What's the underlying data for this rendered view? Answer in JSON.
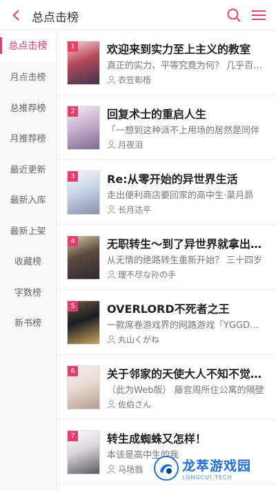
{
  "header": {
    "title": "总点击榜",
    "accent": "#e83c6a"
  },
  "sidebar": {
    "items": [
      {
        "label": "总点击榜",
        "active": true
      },
      {
        "label": "月点击榜"
      },
      {
        "label": "总推荐榜"
      },
      {
        "label": "月推荐榜"
      },
      {
        "label": "最近更新"
      },
      {
        "label": "最新入库"
      },
      {
        "label": "最新上架"
      },
      {
        "label": "收藏榜"
      },
      {
        "label": "字数榜"
      },
      {
        "label": "新书榜"
      }
    ]
  },
  "books": [
    {
      "rank": "1",
      "title": "欢迎来到实力至上主义的教室",
      "desc": "真正的实力、平等究竟为何？ 几乎百分之百",
      "author": "衣笠彰梧",
      "cover_colors": [
        "#b7485a",
        "#f2d7d5",
        "#3d3550"
      ]
    },
    {
      "rank": "2",
      "title": "回复术士的重启人生",
      "desc": "「一想到这种派不上用场的居然是同伴",
      "author": "月夜泪",
      "cover_colors": [
        "#c9b2cf",
        "#f4eef3",
        "#7e6a8e"
      ]
    },
    {
      "rank": "3",
      "title": "Re:从零开始的异世界生活",
      "desc": "走出便利商店要回家的高中生·菜月昴",
      "author": "长月达平",
      "cover_colors": [
        "#c8d5e8",
        "#f7f7fb",
        "#8b8faa"
      ]
    },
    {
      "rank": "4",
      "title": "无职转生～到了异世界就拿出真本事～",
      "desc": "从无情的绝路转生重新开始？ 三十四岁",
      "author": "理不尽な孙の手",
      "cover_colors": [
        "#5a4a3c",
        "#d9c6a8",
        "#2d2a30"
      ]
    },
    {
      "rank": "5",
      "title": "OVERLORD不死者之王",
      "desc": "一款席卷游戏界的网路游戏「YGGDRASIL」",
      "author": "丸山くがね",
      "cover_colors": [
        "#1b1c23",
        "#6e5a38",
        "#c9a75e"
      ]
    },
    {
      "rank": "6",
      "title": "关于邻家的天使大人不知不觉把我惯成了废人这档子事",
      "desc": "（此为Web版） 藤宫周所住公寓的隔壁",
      "author": "佐伯さん",
      "cover_colors": [
        "#e9dcd4",
        "#f7f1ec",
        "#b59c8c"
      ]
    },
    {
      "rank": "7",
      "title": "转生成蜘蛛又怎样！",
      "desc": "本该是高中生的我",
      "author": "马场翁",
      "cover_colors": [
        "#d9d5d9",
        "#ffffff",
        "#5d5963"
      ]
    }
  ],
  "watermark": {
    "main": "龙萃游戏园",
    "sub": "LONGCUI.TECH"
  }
}
